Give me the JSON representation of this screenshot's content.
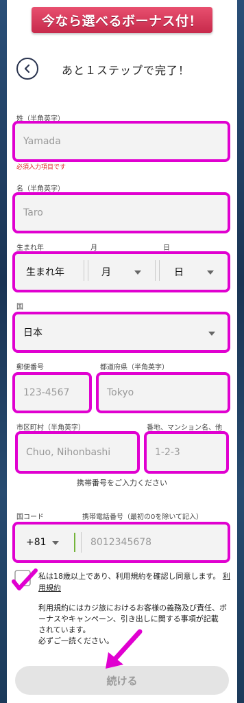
{
  "banner": {
    "text": "今なら選べるボーナス付！"
  },
  "header": {
    "title": "あと１ステップで完了！"
  },
  "form": {
    "last_name": {
      "label": "姓（半角英字）",
      "placeholder": "Yamada",
      "error": "必須入力項目です"
    },
    "first_name": {
      "label": "名（半角英字）",
      "placeholder": "Taro"
    },
    "birth": {
      "label_year": "生まれ年",
      "label_month": "月",
      "label_day": "日",
      "year": "生まれ年",
      "month": "月",
      "day": "日"
    },
    "country": {
      "label": "国",
      "value": "日本"
    },
    "postal": {
      "label": "郵便番号",
      "placeholder": "123-4567"
    },
    "prefecture": {
      "label": "都道府県（半角英字）",
      "placeholder": "Tokyo"
    },
    "city": {
      "label": "市区町村（半角英字）",
      "placeholder": "Chuo, Nihonbashi"
    },
    "street": {
      "label": "番地、マンション名、他",
      "placeholder": "1-2-3"
    },
    "phone_helper": "携帯番号をご入力ください",
    "phone": {
      "code_label": "国コード",
      "number_label": "携帯電話番号（最初の0を除いて記入）",
      "code": "+81",
      "placeholder": "8012345678"
    },
    "agree": {
      "text": "私は18歳以上であり、利用規約を確認し同意します。",
      "link": "利用規約"
    },
    "note_lines": [
      "利用規約にはカジ旅におけるお客様の義務及び責任、ボ",
      "ーナスやキャンペーン、引き出しに関する事項が記載",
      "されています。",
      "必ずご一読ください。"
    ],
    "submit": "続ける"
  },
  "colors": {
    "highlight": "#e000d0",
    "banner": "#d8355a"
  }
}
